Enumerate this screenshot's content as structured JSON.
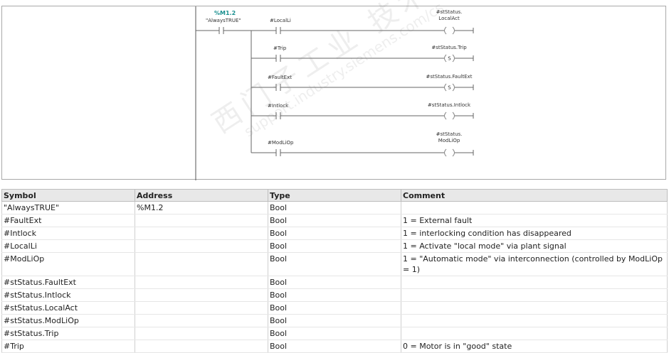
{
  "ladder": {
    "top_address": "%M1.2",
    "top_symbol": "\"AlwaysTRUE\"",
    "rungs": [
      {
        "contact": "#LocalLi",
        "coil_line1": "#stStatus.",
        "coil_line2": "LocalAct",
        "coil_type": ""
      },
      {
        "contact": "#Trip",
        "coil_line1": "#stStatus.Trip",
        "coil_line2": "",
        "coil_type": "S"
      },
      {
        "contact": "#FaultExt",
        "coil_line1": "#stStatus.FaultExt",
        "coil_line2": "",
        "coil_type": "S"
      },
      {
        "contact": "#Intlock",
        "coil_line1": "#stStatus.Intlock",
        "coil_line2": "",
        "coil_type": ""
      },
      {
        "contact": "#ModLiOp",
        "coil_line1": "#stStatus.",
        "coil_line2": "ModLiOp",
        "coil_type": ""
      }
    ]
  },
  "watermark": {
    "line1": "西门子工业  技术论坛",
    "line2": "support.industry.siemens.com/cs"
  },
  "table": {
    "headers": [
      "Symbol",
      "Address",
      "Type",
      "Comment"
    ],
    "rows": [
      [
        "\"AlwaysTRUE\"",
        "%M1.2",
        "Bool",
        ""
      ],
      [
        "#FaultExt",
        "",
        "Bool",
        "1 = External fault"
      ],
      [
        "#Intlock",
        "",
        "Bool",
        "1 = interlocking condition has disappeared"
      ],
      [
        "#LocalLi",
        "",
        "Bool",
        "1 = Activate \"local mode\" via plant signal"
      ],
      [
        "#ModLiOp",
        "",
        "Bool",
        "1 = \"Automatic mode\" via interconnection (controlled by ModLiOp = 1)"
      ],
      [
        "#stStatus.FaultExt",
        "",
        "Bool",
        ""
      ],
      [
        "#stStatus.Intlock",
        "",
        "Bool",
        ""
      ],
      [
        "#stStatus.LocalAct",
        "",
        "Bool",
        ""
      ],
      [
        "#stStatus.ModLiOp",
        "",
        "Bool",
        ""
      ],
      [
        "#stStatus.Trip",
        "",
        "Bool",
        ""
      ],
      [
        "#Trip",
        "",
        "Bool",
        "0 = Motor is in \"good\" state"
      ]
    ]
  }
}
